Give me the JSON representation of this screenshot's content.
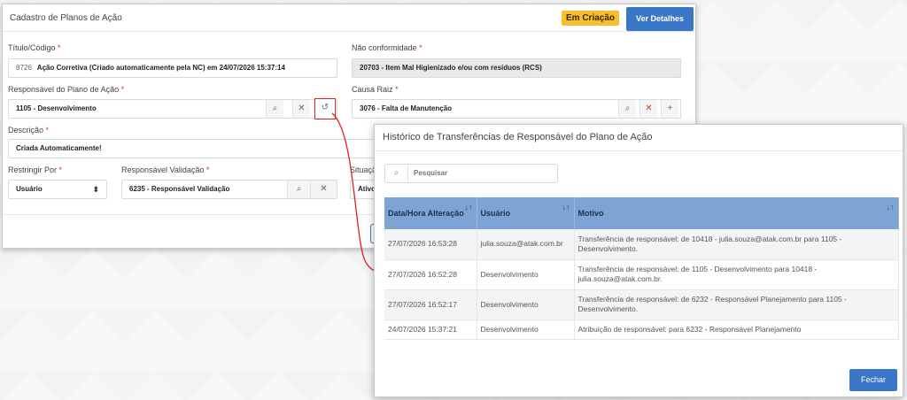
{
  "main": {
    "title": "Cadastro de Planos de Ação",
    "status_badge": "Em Criação",
    "details_button": "Ver Detalhes",
    "fields": {
      "titulo_label": "Título/Código",
      "titulo_code": "8726",
      "titulo_value": "Ação Corretiva (Criado automaticamente pela NC) em 24/07/2026 15:37:14",
      "nc_label": "Não conformidade",
      "nc_value": "20703 - Item Mal Higienizado e/ou com resíduos (RCS)",
      "responsavel_label": "Responsável do Plano de Ação",
      "responsavel_value": "1105 - Desenvolvimento",
      "causa_label": "Causa Raiz",
      "causa_value": "3076 - Falta de Manutenção",
      "descricao_label": "Descrição",
      "descricao_value": "Criada Automaticamente!",
      "restringir_label": "Restringir Por",
      "restringir_value": "Usuário",
      "resp_validacao_label": "Responsável Validação",
      "resp_validacao_value": "6235 - Responsável Validação",
      "situacao_label": "Situação",
      "situacao_value": "Ativo"
    },
    "required_mark": "*"
  },
  "icons": {
    "search": "search-icon",
    "clear": "close-icon",
    "history": "history-icon",
    "add": "plus-icon",
    "select": "select-arrows-icon"
  },
  "modal": {
    "title": "Histórico de Transferências de Responsável do Plano de Ação",
    "search_placeholder": "Pesquisar",
    "columns": [
      "Data/Hora Alteração",
      "Usuário",
      "Motivo"
    ],
    "rows": [
      {
        "datetime": "27/07/2026 16:53:28",
        "user": "julia.souza@atak.com.br",
        "reason": "Transferência de responsável: de 10418 - julia.souza@atak.com.br para 1105 - Desenvolvimento."
      },
      {
        "datetime": "27/07/2026 16:52:28",
        "user": "Desenvolvimento",
        "reason": "Transferência de responsável: de 1105 - Desenvolvimento para 10418 - julia.souza@atak.com.br."
      },
      {
        "datetime": "27/07/2026 16:52:17",
        "user": "Desenvolvimento",
        "reason": "Transferência de responsável: de 6232 - Responsável Planejamento para 1105 - Desenvolvimento."
      },
      {
        "datetime": "24/07/2026 15:37:21",
        "user": "Desenvolvimento",
        "reason": "Atribuição de responsável: para 6232 - Responsável Planejamento"
      }
    ],
    "close_button": "Fechar"
  },
  "colors": {
    "accent": "#3a77c9",
    "badge": "#f7bf2e",
    "highlight": "#e02020",
    "table_header": "#7ea4d6"
  }
}
